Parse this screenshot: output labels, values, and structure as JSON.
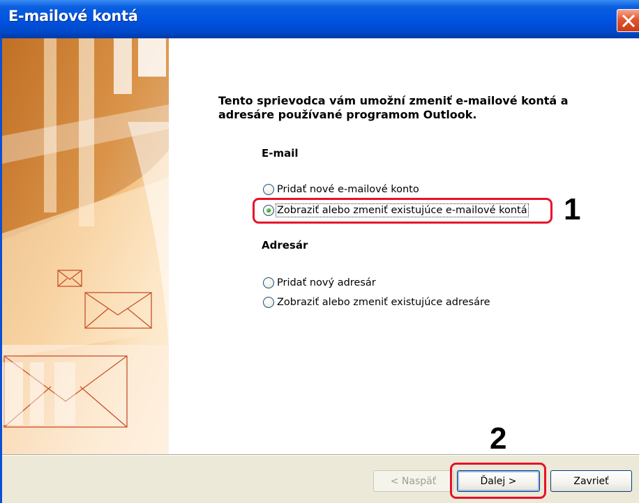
{
  "window": {
    "title": "E-mailové kontá",
    "close_icon": "close-icon"
  },
  "intro_text": "Tento sprievodca vám umožní zmeniť e-mailové kontá a adresáre používané programom Outlook.",
  "email_section": {
    "label": "E-mail",
    "options": [
      {
        "label": "Pridať nové e-mailové konto",
        "checked": false
      },
      {
        "label": "Zobraziť alebo zmeniť existujúce e-mailové kontá",
        "checked": true
      }
    ]
  },
  "addressbook_section": {
    "label": "Adresár",
    "options": [
      {
        "label": "Pridať nový adresár",
        "checked": false
      },
      {
        "label": "Zobraziť alebo zmeniť existujúce adresáre",
        "checked": false
      }
    ]
  },
  "callouts": {
    "step1": "1",
    "step2": "2"
  },
  "buttons": {
    "back": {
      "label": "< Naspäť",
      "enabled": false
    },
    "next": {
      "label": "Ďalej >",
      "enabled": true
    },
    "close": {
      "label": "Zavrieť",
      "enabled": true
    }
  },
  "colors": {
    "titlebar": "#0052e0",
    "highlight": "#e8102a",
    "dialog_bg": "#ece9d8"
  }
}
